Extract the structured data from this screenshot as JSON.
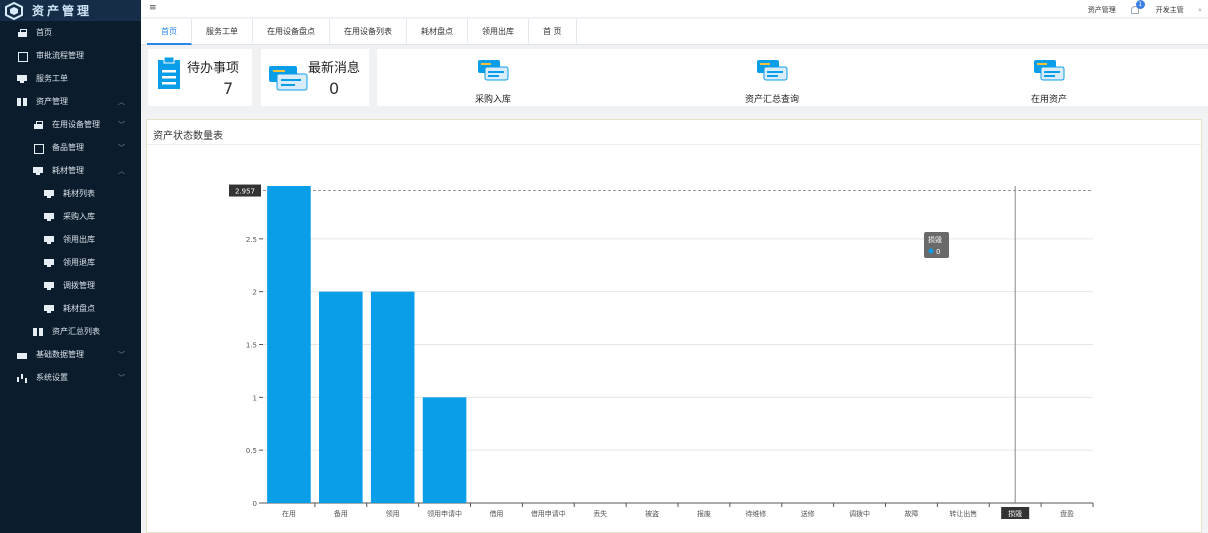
{
  "app": {
    "title": "资产管理"
  },
  "sidebar": {
    "items": [
      {
        "label": "首页",
        "icon": "home-icon",
        "level": 0
      },
      {
        "label": "审批流程管理",
        "icon": "document-icon",
        "level": 0
      },
      {
        "label": "服务工单",
        "icon": "monitor-icon",
        "level": 0
      },
      {
        "label": "资产管理",
        "icon": "split-icon",
        "level": 0,
        "expanded": true
      },
      {
        "label": "在用设备管理",
        "icon": "home-icon",
        "level": 1,
        "expanded": false
      },
      {
        "label": "备品管理",
        "icon": "document-icon",
        "level": 1,
        "expanded": false
      },
      {
        "label": "耗材管理",
        "icon": "monitor-icon",
        "level": 1,
        "expanded": true
      },
      {
        "label": "耗材列表",
        "icon": "monitor-icon",
        "level": 2
      },
      {
        "label": "采购入库",
        "icon": "monitor-icon",
        "level": 2
      },
      {
        "label": "领用出库",
        "icon": "monitor-icon",
        "level": 2
      },
      {
        "label": "领用退库",
        "icon": "monitor-icon",
        "level": 2
      },
      {
        "label": "调拨管理",
        "icon": "monitor-icon",
        "level": 2
      },
      {
        "label": "耗材盘点",
        "icon": "monitor-icon",
        "level": 2
      },
      {
        "label": "资产汇总列表",
        "icon": "split-icon",
        "level": 1
      },
      {
        "label": "基础数据管理",
        "icon": "box-icon",
        "level": 0,
        "expanded": false
      },
      {
        "label": "系统设置",
        "icon": "bar-chart-icon",
        "level": 0,
        "expanded": false
      }
    ]
  },
  "topbar": {
    "menu_icon": "hamburger-icon",
    "module": "资产管理",
    "notification_count": "1",
    "user": "开发主管",
    "collapse_icon": "«"
  },
  "tabs": [
    "首页",
    "服务工单",
    "在用设备盘点",
    "在用设备列表",
    "耗材盘点",
    "领用出库",
    "首 页"
  ],
  "cards": {
    "todo": {
      "title": "待办事项",
      "count": "7"
    },
    "messages": {
      "title": "最新消息",
      "count": "0"
    }
  },
  "quick_links": [
    "采购入库",
    "资产汇总查询",
    "在用资产"
  ],
  "panel": {
    "title": "资产状态数量表"
  },
  "chart_data": {
    "type": "bar",
    "categories": [
      "在用",
      "备用",
      "领用",
      "领用申请中",
      "借用",
      "借用申请中",
      "丢失",
      "被盗",
      "报废",
      "待维修",
      "送修",
      "调拨中",
      "故障",
      "转让出售",
      "损毁",
      "盘盈"
    ],
    "values": [
      3,
      2,
      2,
      1,
      0,
      0,
      0,
      0,
      0,
      0,
      0,
      0,
      0,
      0,
      0,
      0
    ],
    "ylim": [
      0,
      3
    ],
    "yticks": [
      "0",
      "0.5",
      "1",
      "1.5",
      "2",
      "2.5"
    ],
    "bar_color": "#0b9ee8",
    "grid": true,
    "axis_pointer": {
      "value_label": "2.957",
      "highlighted_category": "损毁"
    },
    "tooltip": {
      "title": "损毁",
      "value": "0"
    }
  }
}
